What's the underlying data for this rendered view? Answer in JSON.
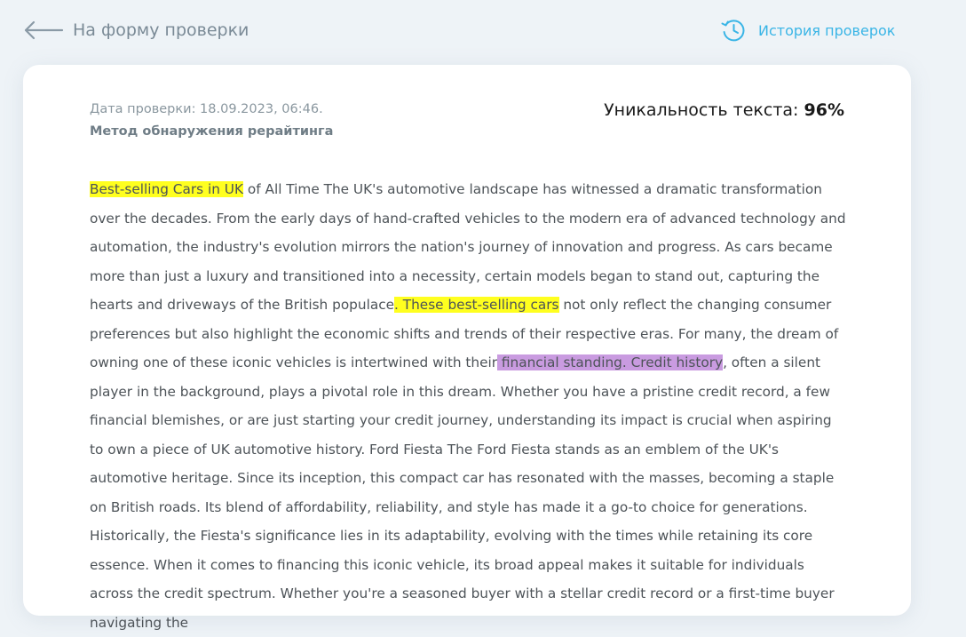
{
  "header": {
    "back_label": "На форму проверки",
    "history_label": "История проверок"
  },
  "report": {
    "date_text": "Дата проверки: 18.09.2023, 06:46.",
    "method_text": "Метод обнаружения рерайтинга",
    "uniqueness_label": "Уникальность текста: ",
    "uniqueness_value": "96%"
  },
  "highlight_colors": {
    "yellow": "#ffff1f",
    "purple": "#c99be0"
  },
  "text_segments": [
    {
      "text": "Best-selling Cars in UK",
      "highlight": "yellow"
    },
    {
      "text": " of All Time The UK's automotive landscape has witnessed a dramatic transformation over the decades. From the early days of hand-crafted vehicles to the modern era of advanced technology and automation, the industry's evolution mirrors the nation's journey of innovation and progress. As cars became more than just a luxury and transitioned into a necessity, certain models began to stand out, capturing the hearts and driveways of the British populace",
      "highlight": "none"
    },
    {
      "text": ". These best-selling cars",
      "highlight": "yellow"
    },
    {
      "text": " not only reflect the changing consumer preferences but also highlight the economic shifts and trends of their respective eras. For many, the dream of owning one of these iconic vehicles is intertwined with their",
      "highlight": "none"
    },
    {
      "text": " financial standing. Credit history",
      "highlight": "purple"
    },
    {
      "text": ", often a silent player in the background, plays a pivotal role in this dream. Whether you have a pristine credit record, a few financial blemishes, or are just starting your credit journey, understanding its impact is crucial when aspiring to own a piece of UK automotive history. Ford Fiesta The Ford Fiesta stands as an emblem of the UK's automotive heritage. Since its inception, this compact car has resonated with the masses, becoming a staple on British roads. Its blend of affordability, reliability, and style has made it a go-to choice for generations. Historically, the Fiesta's significance lies in its adaptability, evolving with the times while retaining its core essence. When it comes to financing this iconic vehicle, its broad appeal makes it suitable for individuals across the credit spectrum. Whether you're a seasoned buyer with a stellar credit record or a first-time buyer navigating the",
      "highlight": "none"
    }
  ]
}
